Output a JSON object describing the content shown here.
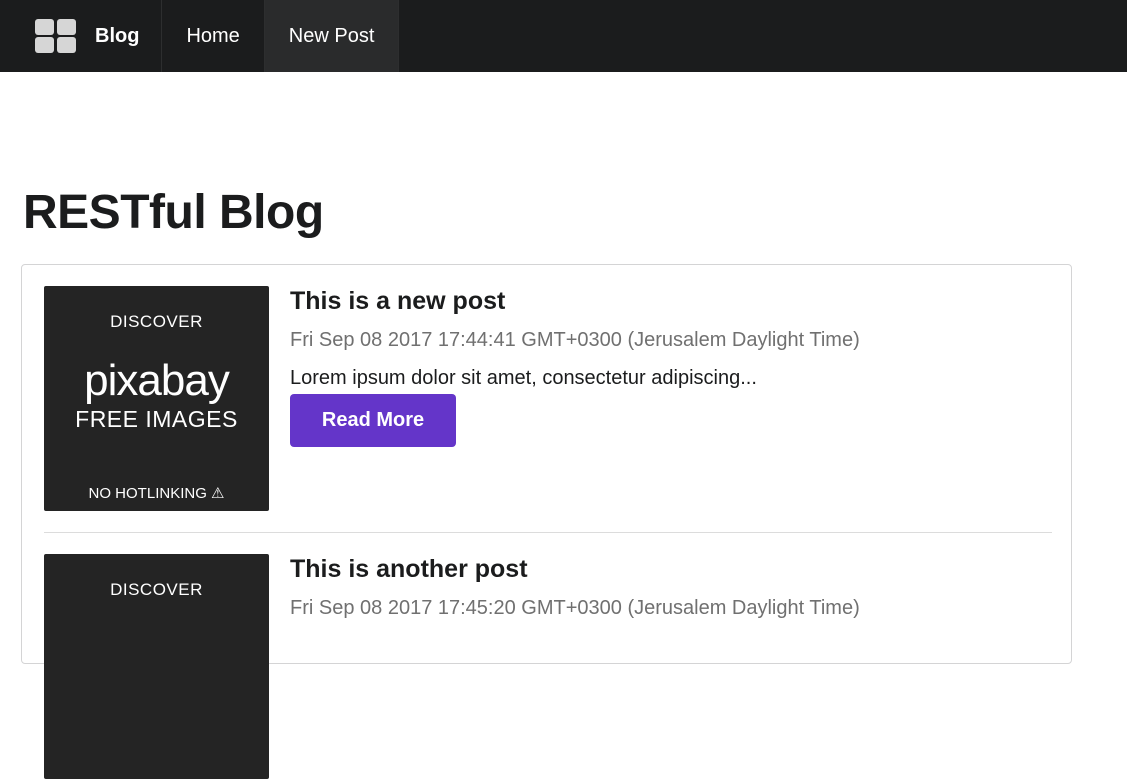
{
  "nav": {
    "brand_label": "Blog",
    "brand_icon": "grid-icon",
    "items": [
      {
        "label": "Home"
      },
      {
        "label": "New Post"
      }
    ]
  },
  "page": {
    "title": "RESTful Blog"
  },
  "posts": [
    {
      "title": "This is a new post",
      "date": "Fri Sep 08 2017 17:44:41 GMT+0300 (Jerusalem Daylight Time)",
      "excerpt": "Lorem ipsum dolor sit amet, consectetur adipiscing...",
      "read_more_label": "Read More",
      "image": {
        "line1": "DISCOVER",
        "line2": "pixabay",
        "line3": "FREE IMAGES",
        "line4": "NO HOTLINKING ⚠"
      }
    },
    {
      "title": "This is another post",
      "date": "Fri Sep 08 2017 17:45:20 GMT+0300 (Jerusalem Daylight Time)",
      "image": {
        "line1": "DISCOVER"
      }
    }
  ],
  "colors": {
    "navbar_bg": "#1b1c1d",
    "button_accent": "#6435c9",
    "thumbnail_bg": "#242424"
  }
}
